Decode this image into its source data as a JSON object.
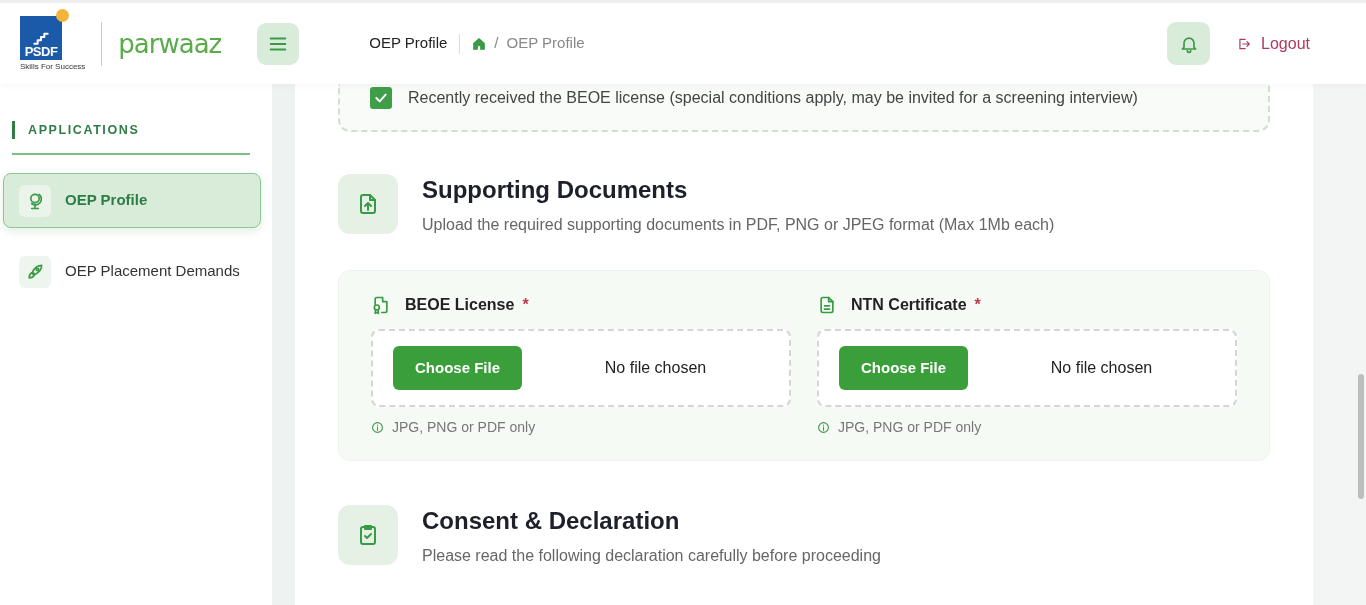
{
  "header": {
    "logo": {
      "mark": "PSDF",
      "tagline": "Skills For Success",
      "brand": "parwaaz"
    },
    "page_title": "OEP Profile",
    "breadcrumb": [
      {
        "separator": "/",
        "label": "OEP Profile"
      }
    ],
    "logout": "Logout"
  },
  "sidebar": {
    "section": "APPLICATIONS",
    "items": [
      {
        "label": "OEP Profile",
        "selected": true
      },
      {
        "label": "OEP Placement Demands",
        "selected": false
      }
    ]
  },
  "declaration_option": {
    "label": "Recently received the BEOE license (special conditions apply, may be invited for a screening interview)",
    "checked": true
  },
  "sections": [
    {
      "kind": "upload",
      "title": "Supporting Documents",
      "subtitle": "Upload the required supporting documents in PDF, PNG or JPEG format (Max 1Mb each)",
      "fields": [
        {
          "label": "BEOE License",
          "required_marker": "*",
          "button": "Choose File",
          "status": "No file chosen",
          "hint": "JPG, PNG or PDF only"
        },
        {
          "label": "NTN Certificate",
          "required_marker": "*",
          "button": "Choose File",
          "status": "No file chosen",
          "hint": "JPG, PNG or PDF only"
        }
      ]
    },
    {
      "kind": "consent",
      "title": "Consent & Declaration",
      "subtitle": "Please read the following declaration carefully before proceeding"
    }
  ]
}
